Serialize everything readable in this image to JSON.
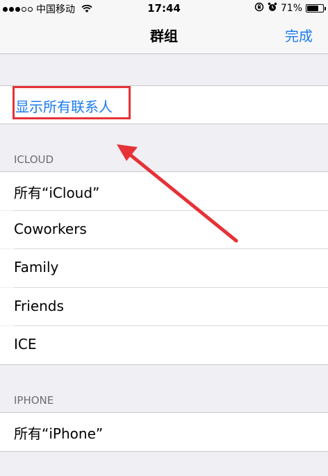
{
  "status_bar": {
    "carrier": "中国移动",
    "time": "17:44",
    "battery_percent": "71%",
    "battery_level": 0.71
  },
  "nav": {
    "title": "群组",
    "done": "完成"
  },
  "show_all_contacts": "显示所有联系人",
  "sections": [
    {
      "header": "ICLOUD",
      "items": [
        "所有“iCloud”",
        "Coworkers",
        "Family",
        "Friends",
        "ICE"
      ]
    },
    {
      "header": "IPHONE",
      "items": [
        "所有“iPhone”"
      ]
    }
  ],
  "colors": {
    "accent": "#1a7bf0",
    "annotation": "#e63237",
    "background": "#efeff4"
  },
  "icons": [
    "wifi-icon",
    "orientation-lock-icon",
    "alarm-icon",
    "battery-icon",
    "annotation-arrow"
  ]
}
